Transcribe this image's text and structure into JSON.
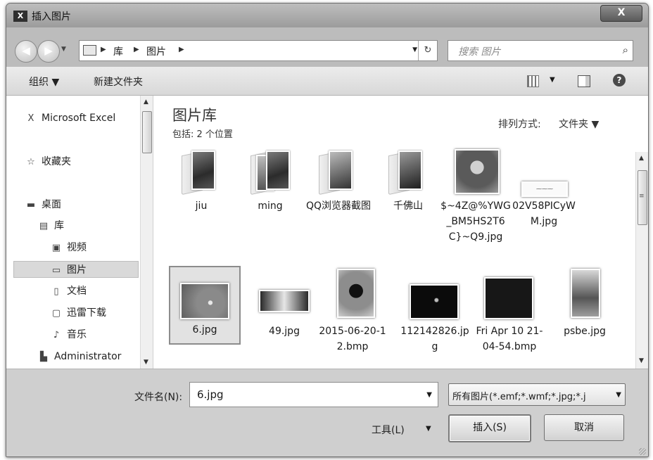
{
  "window": {
    "title": "插入图片",
    "close_label": "X",
    "app_icon_text": "X"
  },
  "nav": {
    "breadcrumbs": [
      "库",
      "图片"
    ],
    "search_placeholder": "搜索 图片"
  },
  "toolbar": {
    "organize": "组织 ▼",
    "new_folder": "新建文件夹",
    "help": "?"
  },
  "sidebar": {
    "items": [
      {
        "label": "Microsoft Excel",
        "icon": "excel-icon",
        "glyph": "X"
      },
      {
        "label": "收藏夹",
        "icon": "star-icon",
        "glyph": "☆"
      },
      {
        "label": "桌面",
        "icon": "desktop-icon",
        "glyph": "▬"
      },
      {
        "label": "库",
        "icon": "library-icon",
        "glyph": "▤"
      },
      {
        "label": "视频",
        "icon": "video-icon",
        "glyph": "▣"
      },
      {
        "label": "图片",
        "icon": "picture-icon",
        "glyph": "▭"
      },
      {
        "label": "文档",
        "icon": "document-icon",
        "glyph": "▯"
      },
      {
        "label": "迅雷下载",
        "icon": "download-icon",
        "glyph": "▢"
      },
      {
        "label": "音乐",
        "icon": "music-icon",
        "glyph": "♪"
      },
      {
        "label": "Administrator",
        "icon": "user-icon",
        "glyph": "▙"
      }
    ]
  },
  "main": {
    "library_title": "图片库",
    "library_subtitle": "包括: 2 个位置",
    "arrange_label": "排列方式:",
    "arrange_value": "文件夹 ▼",
    "files": [
      {
        "name": "jiu",
        "kind": "folder"
      },
      {
        "name": "ming",
        "kind": "folder"
      },
      {
        "name": "QQ浏览器截图",
        "kind": "folder"
      },
      {
        "name": "千佛山",
        "kind": "folder"
      },
      {
        "name": "$~4Z@%YWG_BM5HS2T6C}~Q9.jpg",
        "kind": "image"
      },
      {
        "name": "02V58PICyWM.jpg",
        "kind": "image"
      },
      {
        "name": "6.jpg",
        "kind": "image",
        "selected": true
      },
      {
        "name": "49.jpg",
        "kind": "image"
      },
      {
        "name": "2015-06-20-12.bmp",
        "kind": "image"
      },
      {
        "name": "112142826.jpg",
        "kind": "image"
      },
      {
        "name": "Fri Apr 10 21-04-54.bmp",
        "kind": "image"
      },
      {
        "name": "psbe.jpg",
        "kind": "image"
      }
    ]
  },
  "bottom": {
    "filename_label": "文件名(N):",
    "filename_value": "6.jpg",
    "filetype_value": "所有图片(*.emf;*.wmf;*.jpg;*.j",
    "tools_label": "工具(L)",
    "insert_label": "插入(S)",
    "cancel_label": "取消"
  }
}
